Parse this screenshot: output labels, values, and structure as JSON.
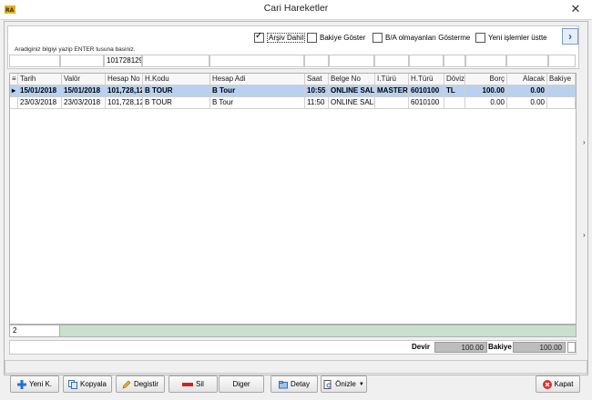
{
  "window": {
    "title": "Cari Hareketler",
    "close_symbol": "✕"
  },
  "filters": {
    "arsiv_dahil": {
      "label": "Arşiv Dahil",
      "checked": true
    },
    "bakiye_goster": {
      "label": "Bakiye Göster",
      "checked": false
    },
    "ba_gosterme": {
      "label": "B/A olmayanları Gösterme",
      "checked": false
    },
    "yeni_ustte": {
      "label": "Yeni işlemler üstte",
      "checked": false
    },
    "next_symbol": "›"
  },
  "hint": "Aradiginiz bilgiyi yazip ENTER tusuna basiniz.",
  "search_row": [
    "",
    "",
    "101728129",
    "",
    "",
    "",
    "",
    "",
    "",
    "",
    "",
    "",
    ""
  ],
  "grid": {
    "columns": [
      "Tarih",
      "Valör",
      "Hesap No",
      "H.Kodu",
      "Hesap Adi",
      "Saat",
      "Belge No",
      "I.Türü",
      "H.Türü",
      "Döviz",
      "Borç",
      "Alacak",
      "Bakiye"
    ],
    "rows": [
      [
        "15/01/2018",
        "15/01/2018",
        "101,728,12",
        "B TOUR",
        "B Tour",
        "10:55",
        "ONLINE SALI",
        "MASTER",
        "6010100",
        "TL",
        "100.00",
        "0.00",
        ""
      ],
      [
        "23/03/2018",
        "23/03/2018",
        "101,728,12",
        "B TOUR",
        "B Tour",
        "11:50",
        "ONLINE SALI",
        "",
        "6010100",
        "",
        "0.00",
        "0.00",
        ""
      ]
    ],
    "record_count": "2"
  },
  "totals": {
    "devir_label": "Devir",
    "devir_value": "100.00",
    "bakiye_label": "Bakiye",
    "bakiye_value": "100.00"
  },
  "toolbar": {
    "yeni": "Yeni K.",
    "kopyala": "Kopyala",
    "degistir": "Degistir",
    "sil": "Sil",
    "diger": "Diger",
    "detay": "Detay",
    "onizle": "Önizle",
    "kapat": "Kapat"
  },
  "colors": {
    "selection": "#b9d1ee",
    "footer_green": "#c8e0cc",
    "close_red": "#d9302a"
  }
}
